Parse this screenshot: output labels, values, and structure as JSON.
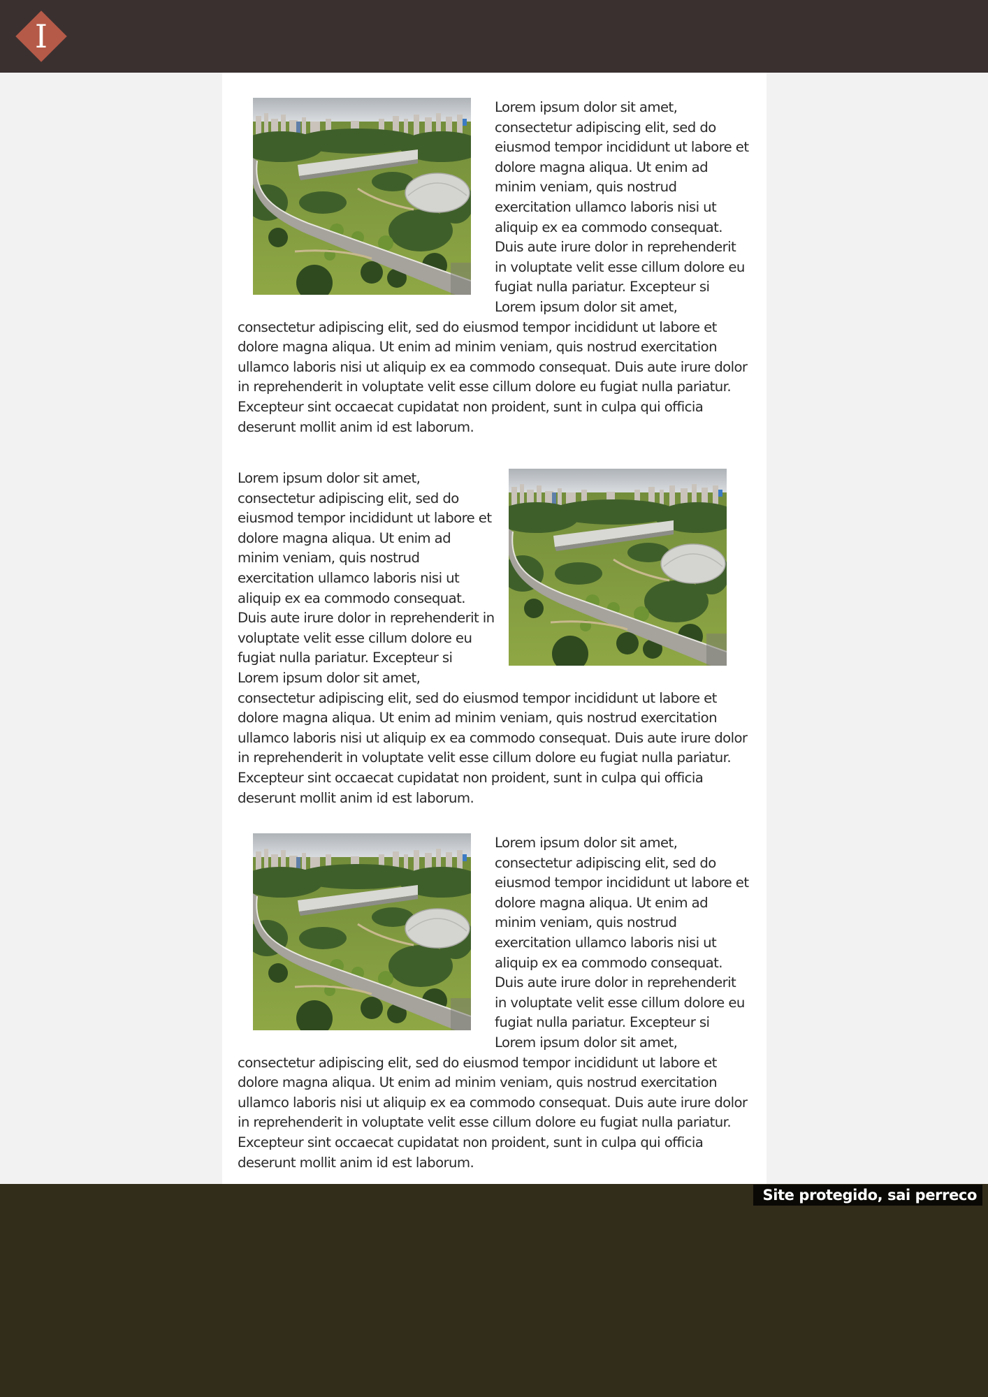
{
  "header": {
    "logo_letter": "I",
    "logo_icon": "diamond-logo-icon",
    "logo_color": "#b55a48",
    "background_color": "#3a3030"
  },
  "articles": [
    {
      "image": "aerial-park-photo",
      "image_side": "left",
      "float_text": "Lorem ipsum dolor sit amet, consectetur adipiscing elit, sed do eiusmod tempor incididunt ut labore et dolore magna aliqua. Ut enim ad minim veniam, quis nostrud exercitation ullamco laboris nisi ut aliquip ex ea commodo consequat. Duis aute irure dolor in reprehenderit in voluptate velit esse cillum dolore eu fugiat nulla pariatur. Excepteur si",
      "body_text": "Lorem ipsum dolor sit amet, consectetur adipiscing elit, sed do eiusmod tempor incididunt ut labore et dolore magna aliqua. Ut enim ad minim veniam, quis nostrud exercitation ullamco laboris nisi ut aliquip ex ea commodo consequat. Duis aute irure dolor in reprehenderit in voluptate velit esse cillum dolore eu fugiat nulla pariatur. Excepteur sint occaecat cupidatat non proident, sunt in culpa qui officia deserunt mollit anim id est laborum."
    },
    {
      "image": "aerial-park-photo",
      "image_side": "right",
      "float_text": "Lorem ipsum dolor sit amet, consectetur adipiscing elit, sed do eiusmod tempor incididunt ut labore et dolore magna aliqua. Ut enim ad minim veniam, quis nostrud exercitation ullamco laboris nisi ut aliquip ex ea commodo consequat. Duis aute irure dolor in reprehenderit in voluptate velit esse cillum dolore eu fugiat nulla pariatur. Excepteur si",
      "body_text": "Lorem ipsum dolor sit amet, consectetur adipiscing elit, sed do eiusmod tempor incididunt ut labore et dolore magna aliqua. Ut enim ad minim veniam, quis nostrud exercitation ullamco laboris nisi ut aliquip ex ea commodo consequat. Duis aute irure dolor in reprehenderit in voluptate velit esse cillum dolore eu fugiat nulla pariatur. Excepteur sint occaecat cupidatat non proident, sunt in culpa qui officia deserunt mollit anim id est laborum."
    },
    {
      "image": "aerial-park-photo",
      "image_side": "left",
      "float_text": "Lorem ipsum dolor sit amet, consectetur adipiscing elit, sed do eiusmod tempor incididunt ut labore et dolore magna aliqua. Ut enim ad minim veniam, quis nostrud exercitation ullamco laboris nisi ut aliquip ex ea commodo consequat. Duis aute irure dolor in reprehenderit in voluptate velit esse cillum dolore eu fugiat nulla pariatur. Excepteur si",
      "body_text": "Lorem ipsum dolor sit amet, consectetur adipiscing elit, sed do eiusmod tempor incididunt ut labore et dolore magna aliqua. Ut enim ad minim veniam, quis nostrud exercitation ullamco laboris nisi ut aliquip ex ea commodo consequat. Duis aute irure dolor in reprehenderit in voluptate velit esse cillum dolore eu fugiat nulla pariatur. Excepteur sint occaecat cupidatat non proident, sunt in culpa qui officia deserunt mollit anim id est laborum."
    }
  ],
  "footer": {
    "badge_text": "Site protegido, sai perreco",
    "background_color": "#322c1a"
  }
}
